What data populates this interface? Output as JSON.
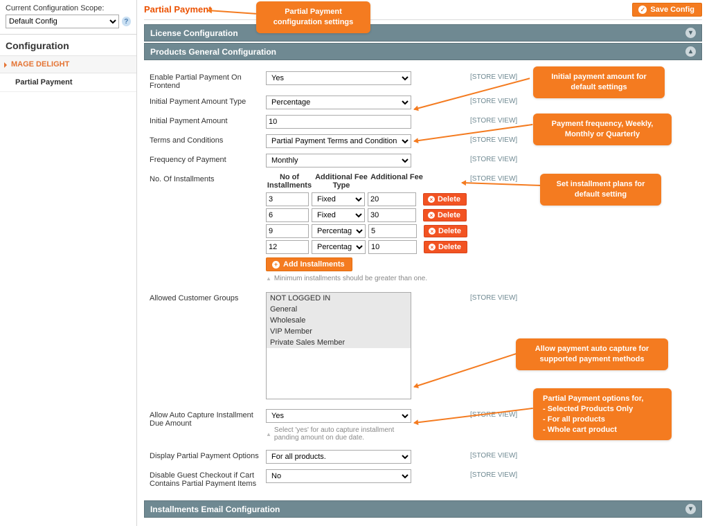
{
  "sidebar": {
    "scope_label": "Current Configuration Scope:",
    "scope_value": "Default Config",
    "config_heading": "Configuration",
    "nav_section": "MAGE DELIGHT",
    "nav_item": "Partial Payment"
  },
  "header": {
    "title": "Partial Payment",
    "save": "Save Config"
  },
  "sections": {
    "license": "License Configuration",
    "products": "Products General Configuration",
    "email": "Installments Email Configuration"
  },
  "scope_text": "[STORE VIEW]",
  "form": {
    "enable_label": "Enable Partial Payment On Frontend",
    "enable_value": "Yes",
    "amount_type_label": "Initial Payment Amount Type",
    "amount_type_value": "Percentage",
    "amount_label": "Initial Payment Amount",
    "amount_value": "10",
    "terms_label": "Terms and Conditions",
    "terms_value": "Partial Payment Terms and Conditions",
    "freq_label": "Frequency of Payment",
    "freq_value": "Monthly",
    "inst_label": "No. Of Installments",
    "inst_headers": {
      "c1": "No of Installments",
      "c2": "Additional Fee Type",
      "c3": "Additional Fee"
    },
    "inst_rows": [
      {
        "n": "3",
        "type": "Fixed",
        "fee": "20"
      },
      {
        "n": "6",
        "type": "Fixed",
        "fee": "30"
      },
      {
        "n": "9",
        "type": "Percentage",
        "fee": "5"
      },
      {
        "n": "12",
        "type": "Percentage",
        "fee": "10"
      }
    ],
    "delete": "Delete",
    "add": "Add Installments",
    "inst_hint": "Minimum installments should be greater than one.",
    "groups_label": "Allowed Customer Groups",
    "groups": [
      "NOT LOGGED IN",
      "General",
      "Wholesale",
      "VIP Member",
      "Private Sales Member"
    ],
    "autocap_label": "Allow Auto Capture Installment Due Amount",
    "autocap_value": "Yes",
    "autocap_hint": "Select 'yes' for auto capture installment panding amount on due date.",
    "display_label": "Display Partial Payment Options",
    "display_value": "For all products.",
    "guest_label": "Disable Guest Checkout if Cart Contains Partial Payment Items",
    "guest_value": "No"
  },
  "callouts": {
    "c1": "Partial Payment configuration settings",
    "c2": "Initial payment amount for default settings",
    "c3": "Payment frequency, Weekly, Monthly or Quarterly",
    "c4": "Set installment plans for default setting",
    "c5": "Allow payment auto capture for supported payment methods",
    "c6": "Partial Payment options for,\n- Selected Products Only\n- For all products\n- Whole cart product"
  }
}
